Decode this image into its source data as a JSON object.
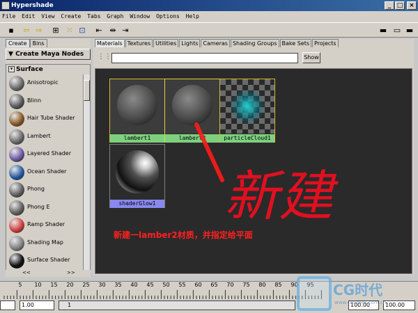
{
  "window": {
    "title": "Hypershade"
  },
  "menu": [
    "File",
    "Edit",
    "View",
    "Create",
    "Tabs",
    "Graph",
    "Window",
    "Options",
    "Help"
  ],
  "left_panel": {
    "tabs": [
      "Create",
      "Bins"
    ],
    "header": "Create Maya Nodes",
    "section": "Surface",
    "nodes": [
      {
        "label": "Anisotropic",
        "color": "#6a6a6a"
      },
      {
        "label": "Blinn",
        "color": "#5a5a5a"
      },
      {
        "label": "Hair Tube Shader",
        "color": "#8a5a2a"
      },
      {
        "label": "Lambert",
        "color": "#6a6a6a"
      },
      {
        "label": "Layered Shader",
        "color": "#6a5aa0"
      },
      {
        "label": "Ocean Shader",
        "color": "#2a5aa0"
      },
      {
        "label": "Phong",
        "color": "#606060"
      },
      {
        "label": "Phong E",
        "color": "#606060"
      },
      {
        "label": "Ramp Shader",
        "color": "#d04040"
      },
      {
        "label": "Shading Map",
        "color": "#808080"
      },
      {
        "label": "Surface Shader",
        "color": "#101010"
      }
    ],
    "scroll_left": "<<",
    "scroll_right": ">>"
  },
  "right_panel": {
    "tabs": [
      "Materials",
      "Textures",
      "Utilities",
      "Lights",
      "Cameras",
      "Shading Groups",
      "Bake Sets",
      "Projects"
    ],
    "active_tab": "Materials",
    "show_button": "Show",
    "search_value": "",
    "swatches": [
      {
        "name": "lambert1",
        "label_color": "#7ed07e"
      },
      {
        "name": "lambert2",
        "label_color": "#7ed07e"
      },
      {
        "name": "particleCloud1",
        "label_color": "#7ed07e"
      },
      {
        "name": "shaderGlow1",
        "label_color": "#8888ee"
      }
    ],
    "annotation": "新建一lamber2材质，并指定给平面",
    "handwriting": "新建"
  },
  "timeline": {
    "ticks": [
      "5",
      "10",
      "15",
      "20",
      "25",
      "30",
      "35",
      "40",
      "45",
      "50",
      "55",
      "60",
      "65",
      "70",
      "75",
      "80",
      "85",
      "90",
      "95"
    ],
    "start": "1.00",
    "current": "1",
    "end_a": "100.00",
    "end_b": "100.00"
  },
  "watermark": {
    "text": "CG时代",
    "url": "www.cgtimes.com.cn"
  }
}
